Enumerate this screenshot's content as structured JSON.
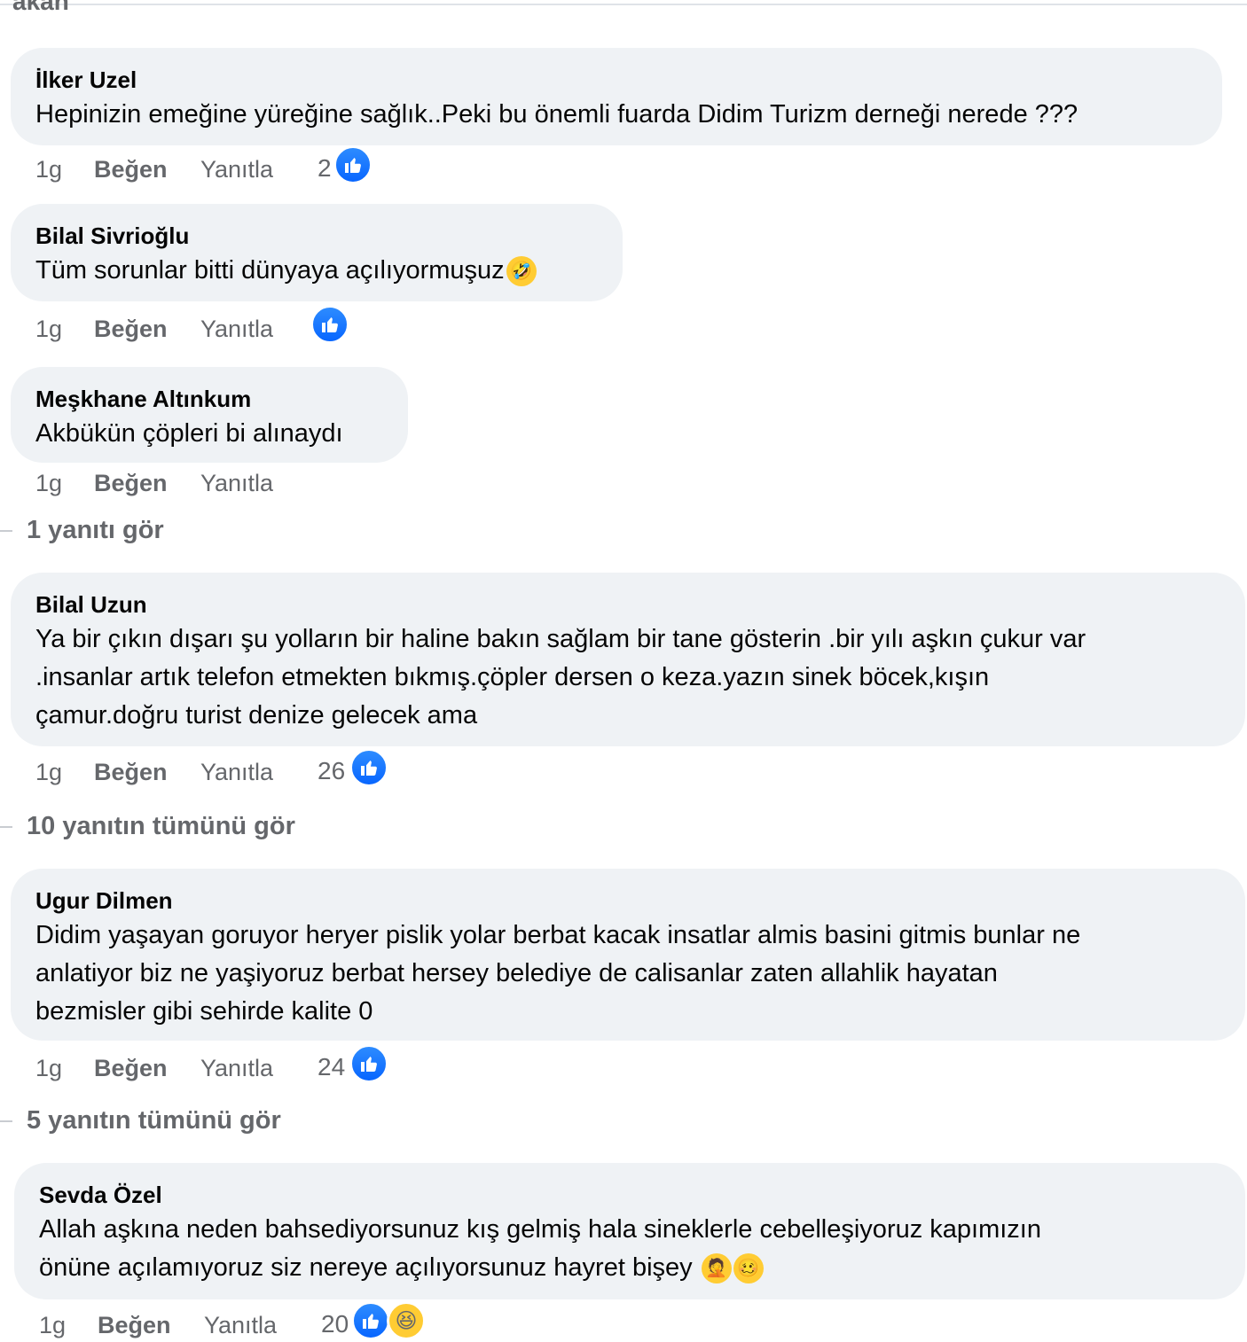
{
  "header": {
    "partial_label": "akan"
  },
  "comments": [
    {
      "author": "İlker Uzel",
      "text": "Hepinizin emeğine yüreğine sağlık..Peki bu önemli fuarda Didim Turizm derneği nerede ???",
      "time": "1g",
      "like_label": "Beğen",
      "reply_label": "Yanıtla",
      "count": "2"
    },
    {
      "author": "Bilal Sivrioğlu",
      "text": "Tüm sorunlar bitti dünyaya açılıyormuşuz",
      "text_emoji": "🤣",
      "time": "1g",
      "like_label": "Beğen",
      "reply_label": "Yanıtla",
      "count": ""
    },
    {
      "author": "Meşkhane Altınkum",
      "text": "Akbükün çöpleri bi alınaydı",
      "time": "1g",
      "like_label": "Beğen",
      "reply_label": "Yanıtla",
      "see_replies": "1 yanıtı gör"
    },
    {
      "author": "Bilal Uzun",
      "text_lines": [
        "Ya bir çıkın dışarı şu yolların bir haline bakın sağlam bir tane gösterin .bir yılı aşkın çukur var",
        ".insanlar artık telefon etmekten bıkmış.çöpler dersen o keza.yazın sinek böcek,kışın",
        "çamur.doğru turist denize gelecek ama"
      ],
      "time": "1g",
      "like_label": "Beğen",
      "reply_label": "Yanıtla",
      "count": "26",
      "see_replies": "10 yanıtın tümünü gör"
    },
    {
      "author": "Ugur Dilmen",
      "text_lines": [
        "Didim yaşayan goruyor heryer pislik yolar berbat kacak insatlar almis basini gitmis bunlar ne",
        "anlatiyor biz ne yaşiyoruz berbat hersey belediye de calisanlar zaten allahlik hayatan",
        "bezmisler gibi sehirde kalite 0"
      ],
      "time": "1g",
      "like_label": "Beğen",
      "reply_label": "Yanıtla",
      "count": "24",
      "see_replies": "5 yanıtın tümünü gör"
    },
    {
      "author": "Sevda Özel",
      "text_lines": [
        "Allah aşkına neden bahsediyorsunuz kış gelmiş hala sineklerle cebelleşiyoruz kapımızın",
        "önüne açılamıyoruz siz nereye açılıyorsunuz hayret bişey"
      ],
      "text_emojis": [
        "🤦",
        "🥴"
      ],
      "time": "1g",
      "like_label": "Beğen",
      "reply_label": "Yanıtla",
      "count": "20"
    }
  ],
  "icons": {
    "like_reaction": "thumbs-up-icon",
    "haha_reaction": "haha-icon"
  },
  "colors": {
    "bubble": "#eff2f5",
    "like_blue": "#0866ff",
    "secondary_text": "#65676b"
  }
}
